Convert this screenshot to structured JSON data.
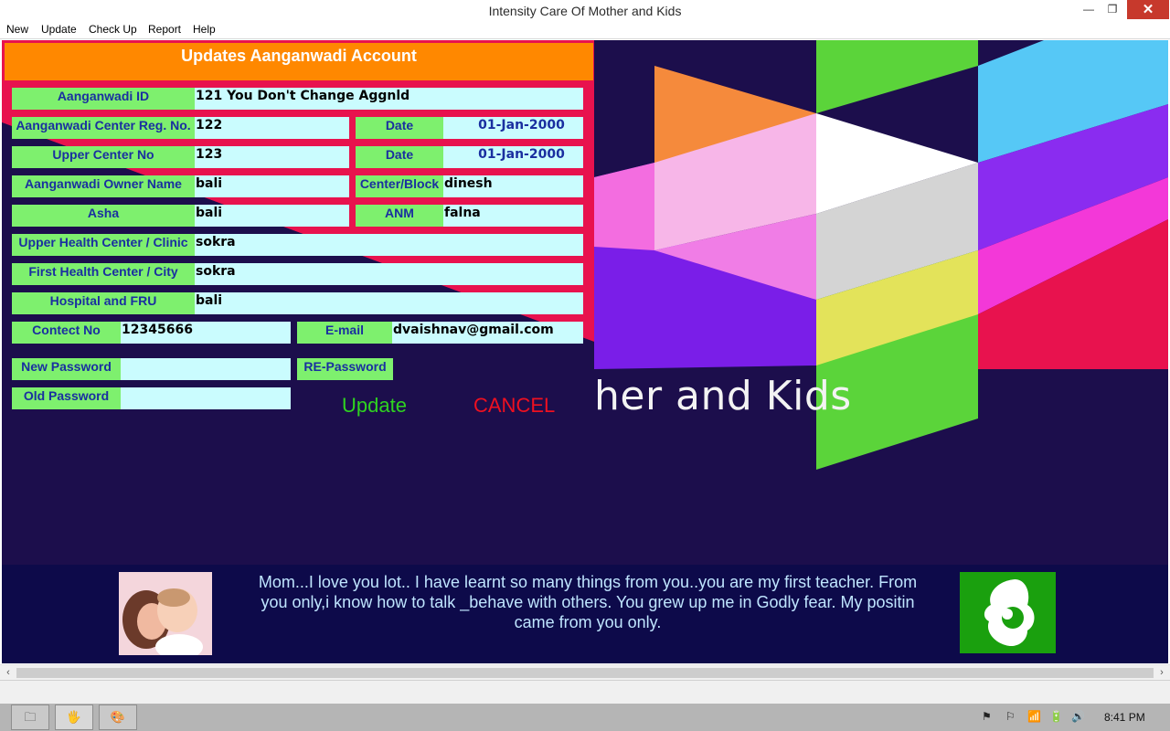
{
  "window": {
    "title": "Intensity Care Of Mother and Kids",
    "controls": {
      "minimize": "—",
      "maximize": "❐",
      "close": "✕"
    }
  },
  "menu": [
    "New",
    "Update",
    "Check Up",
    "Report",
    "Help"
  ],
  "form": {
    "title": "Updates Aanganwadi Account",
    "aanganwadi_id": {
      "label": "Aanganwadi ID",
      "value": "121  You Don't Change Aggnld"
    },
    "center_reg_no": {
      "label": "Aanganwadi Center Reg. No.",
      "value": "122"
    },
    "reg_date": {
      "label": "Date",
      "value": "01-Jan-2000"
    },
    "upper_center_no": {
      "label": "Upper Center No",
      "value": "123"
    },
    "upper_date": {
      "label": "Date",
      "value": "01-Jan-2000"
    },
    "owner_name": {
      "label": "Aanganwadi Owner Name",
      "value": "bali"
    },
    "center_block": {
      "label": "Center/Block",
      "value": "dinesh"
    },
    "asha": {
      "label": "Asha",
      "value": "bali"
    },
    "anm": {
      "label": "ANM",
      "value": "falna"
    },
    "upper_health_center": {
      "label": "Upper Health Center / Clinic",
      "value": "sokra"
    },
    "first_health_center": {
      "label": "First Health Center / City",
      "value": "sokra"
    },
    "hospital_fru": {
      "label": "Hospital and FRU",
      "value": "bali"
    },
    "contact_no": {
      "label": "Contect No",
      "value": "12345666"
    },
    "email": {
      "label": "E-mail",
      "value": "dvaishnav@gmail.com"
    },
    "new_password": {
      "label": "New Password",
      "value": ""
    },
    "re_password": {
      "label": "RE-Password",
      "value": ""
    },
    "old_password": {
      "label": "Old Password",
      "value": ""
    },
    "update_label": "Update",
    "cancel_label": "CANCEL"
  },
  "background": {
    "brand_text": "her and Kids"
  },
  "footer": {
    "quote": "Mom...I love you lot.. I have learnt so many things from you..you are my first teacher. From you only,i know how to talk _behave with others. You grew up me in Godly fear. My positin came from you only."
  },
  "scroll": {
    "left_arrow": "‹",
    "right_arrow": "›"
  },
  "taskbar": {
    "buttons": [
      "🗀",
      "🖐",
      "🎨"
    ],
    "tray": [
      "⚑",
      "⚐",
      "📶",
      "🔋",
      "🔊"
    ],
    "clock": "8:41 PM"
  },
  "colors": {
    "canvas_bg": "#1c0e4c",
    "header_orange": "#ff8800",
    "label_green": "#7ef06e",
    "field_cyan": "#cafcfe",
    "label_text_blue": "#1a2fa0",
    "update_green": "#2fd320",
    "cancel_red": "#ee1020"
  }
}
